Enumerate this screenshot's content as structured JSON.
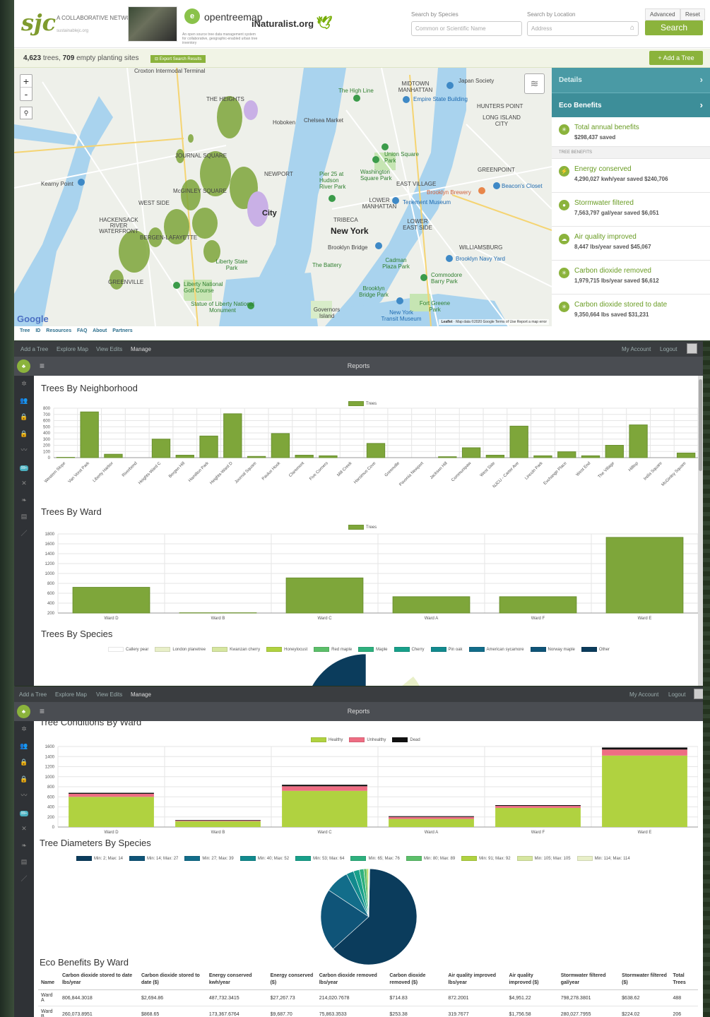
{
  "panel1": {
    "logo": {
      "sjc": "sjc",
      "network": "A COLLABORATIVE NETWORK",
      "url": "sustainablejc.org",
      "otm_name": "opentreemap",
      "otm_tagline": "An open source tree data management system for collaborative, geographic-enabled urban tree inventory",
      "inat": "iNaturalist.org"
    },
    "search": {
      "species_label": "Search by Species",
      "species_placeholder": "Common or Scientific Name",
      "location_label": "Search by Location",
      "location_placeholder": "Address",
      "advanced": "Advanced",
      "reset": "Reset",
      "search_button": "Search"
    },
    "counts": {
      "trees": "4,623",
      "trees_word": "trees,",
      "empty": "709",
      "empty_word": "empty planting sites"
    },
    "export_button": "Export Search Results",
    "add_tree_button": "+ Add a Tree",
    "map": {
      "zoom_in": "+",
      "zoom_out": "-",
      "google": "Google",
      "attribution": "Map data ©2020 Google   Terms of Use   Report a map error",
      "leaflet": "Leaflet",
      "labels": [
        "Croxton Intermodal Terminal",
        "THE HEIGHTS",
        "Hoboken",
        "Kearny Point",
        "JOURNAL SQUARE",
        "NEWPORT",
        "WEST SIDE",
        "McGINLEY SQUARE",
        "HACKENSACK RIVER WATERFRONT",
        "BERGEN-LAFAYETTE",
        "GREENVILLE",
        "Liberty State Park",
        "Liberty National Golf Course",
        "Statue of Liberty National Monument",
        "Governors Island",
        "New York",
        "TRIBECA",
        "LOWER MANHATTAN",
        "EAST VILLAGE",
        "LOWER EAST SIDE",
        "MIDTOWN MANHATTAN",
        "The High Line",
        "Empire State Building",
        "Chelsea Market",
        "Union Square Park",
        "Washington Square Park",
        "Pier 25 at Hudson River Park",
        "Brooklyn Bridge",
        "The Battery",
        "Cadman Plaza Park",
        "Brooklyn Bridge Park",
        "WILLIAMSBURG",
        "Brooklyn Navy Yard",
        "Commodore Barry Park",
        "Fort Greene Park",
        "GREENPOINT",
        "HUNTERS POINT",
        "LONG ISLAND CITY",
        "Brooklyn Brewery",
        "Beacon's Closet",
        "Tenement Museum",
        "Japan Society",
        "City",
        "New York Transit Museum"
      ]
    },
    "sidebar": {
      "details": "Details",
      "eco": "Eco Benefits",
      "total": {
        "name": "Total annual benefits",
        "value": "$298,437 saved"
      },
      "tree_benefits_header": "TREE BENEFITS",
      "benefits": [
        {
          "icon": "lightning-icon",
          "glyph": "⚡",
          "name": "Energy conserved",
          "value": "4,290,027 kwh/year saved $240,706"
        },
        {
          "icon": "water-drop-icon",
          "glyph": "●",
          "name": "Stormwater filtered",
          "value": "7,563,797 gal/year saved $6,051"
        },
        {
          "icon": "cloud-icon",
          "glyph": "☁",
          "name": "Air quality improved",
          "value": "8,447 lbs/year saved $45,067"
        },
        {
          "icon": "co2-icon",
          "glyph": "✳",
          "name": "Carbon dioxide removed",
          "value": "1,979,715 lbs/year saved $6,612"
        },
        {
          "icon": "co2-icon",
          "glyph": "✳",
          "name": "Carbon dioxide stored to date",
          "value": "9,350,664 lbs saved $31,231"
        }
      ]
    },
    "footer": "Tree ID   Resources   FAQ   About   Partners"
  },
  "manage": {
    "nav": [
      "Add a Tree",
      "Explore Map",
      "View Edits",
      "Manage"
    ],
    "account": "My Account",
    "logout": "Logout",
    "title": "Reports",
    "badge": "99+"
  },
  "colors": {
    "green": "#8bb33c",
    "teal": "#3d8e99",
    "healthy": "#b0d240",
    "unhealthy": "#ee6d83",
    "dead": "#111111"
  },
  "chart_data": [
    {
      "type": "bar",
      "title": "Trees By Neighborhood",
      "legend": [
        "Trees"
      ],
      "categories": [
        "Western Slope",
        "Van Vorst Park",
        "Liberty Harbor",
        "Riverbend",
        "Heights-Ward C",
        "Bergen Hill",
        "Hamilton Park",
        "Heights-Ward D",
        "Journal Square",
        "Paulus Hook",
        "Claremont",
        "Five Corners",
        "Mill Creek",
        "Harsimus Cove",
        "Greenville",
        "Pavonia Newport",
        "Jackson Hill",
        "Communipaw",
        "West Side",
        "NJCU - Carter Ave",
        "Lincoln Park",
        "Exchange Place",
        "West End",
        "The Village",
        "Hilltop",
        "India Square",
        "McGinley Square"
      ],
      "values": [
        5,
        740,
        55,
        0,
        300,
        40,
        350,
        710,
        20,
        390,
        40,
        30,
        0,
        230,
        0,
        0,
        15,
        160,
        40,
        510,
        30,
        95,
        30,
        200,
        530,
        0,
        75
      ],
      "ylim": [
        0,
        800
      ],
      "yticks": [
        0,
        100,
        200,
        300,
        400,
        500,
        600,
        700,
        800
      ]
    },
    {
      "type": "bar",
      "title": "Trees By Ward",
      "legend": [
        "Trees"
      ],
      "categories": [
        "Ward D",
        "Ward B",
        "Ward C",
        "Ward A",
        "Ward F",
        "Ward E"
      ],
      "values": [
        720,
        205,
        910,
        530,
        530,
        1730
      ],
      "ylim": [
        200,
        1800
      ],
      "yticks": [
        200,
        400,
        600,
        800,
        1000,
        1200,
        1400,
        1600,
        1800
      ]
    },
    {
      "type": "pie",
      "title": "Trees By Species",
      "categories": [
        "Callery pear",
        "London planetree",
        "Kwanzan cherry",
        "Honeylocust",
        "Red maple",
        "Maple",
        "Cherry",
        "Pin oak",
        "American sycamore",
        "Norway maple",
        "Other"
      ],
      "colors": [
        "#ffffff",
        "#e8efc8",
        "#d6e6a0",
        "#b0d240",
        "#5cbf6a",
        "#2eb07e",
        "#18a08a",
        "#128a8e",
        "#126d8a",
        "#0f5478",
        "#0b3c5c"
      ],
      "values": [
        14,
        7,
        3,
        8,
        6,
        3,
        2,
        2,
        3,
        2,
        50
      ]
    },
    {
      "type": "bar",
      "stacked": true,
      "title": "Tree Conditions By Ward",
      "categories": [
        "Ward D",
        "Ward B",
        "Ward C",
        "Ward A",
        "Ward F",
        "Ward E"
      ],
      "series": [
        {
          "name": "Healthy",
          "values": [
            600,
            115,
            720,
            160,
            380,
            1420
          ]
        },
        {
          "name": "Unhealthy",
          "values": [
            60,
            15,
            90,
            40,
            40,
            120
          ]
        },
        {
          "name": "Dead",
          "values": [
            20,
            10,
            30,
            15,
            15,
            40
          ]
        }
      ],
      "ylim": [
        0,
        1600
      ],
      "yticks": [
        0,
        200,
        400,
        600,
        800,
        1000,
        1200,
        1400,
        1600
      ]
    },
    {
      "type": "pie",
      "title": "Tree Diameters By Species",
      "categories": [
        "Min: 2; Max: 14",
        "Min: 14; Max: 27",
        "Min: 27; Max: 39",
        "Min: 40; Max: 52",
        "Min: 53; Max: 64",
        "Min: 65; Max: 76",
        "Min: 80; Max: 89",
        "Min: 91; Max: 92",
        "Min: 105; Max: 105",
        "Min: 114; Max: 114"
      ],
      "colors": [
        "#0b3c5c",
        "#0f5478",
        "#126d8a",
        "#128a8e",
        "#18a08a",
        "#2eb07e",
        "#5cbf6a",
        "#b0d240",
        "#d6e6a0",
        "#e8efc8"
      ],
      "values": [
        63,
        21,
        8,
        2.5,
        2,
        1.5,
        1,
        0.5,
        0.3,
        0.2
      ]
    },
    {
      "type": "table",
      "title": "Eco Benefits By Ward",
      "columns": [
        "Name",
        "Carbon dioxide stored to date lbs/year",
        "Carbon dioxide stored to date ($)",
        "Energy conserved kwh/year",
        "Energy conserved ($)",
        "Carbon dioxide removed lbs/year",
        "Carbon dioxide removed ($)",
        "Air quality improved lbs/year",
        "Air quality improved ($)",
        "Stormwater filtered gal/year",
        "Stormwater filtered ($)",
        "Total Trees"
      ],
      "rows": [
        [
          "Ward A",
          "806,844.3018",
          "$2,694.86",
          "487,732.3415",
          "$27,267.73",
          "214,020.7678",
          "$714.83",
          "872.2001",
          "$4,951.22",
          "798,278.3801",
          "$638.62",
          "488"
        ],
        [
          "Ward B",
          "260,073.8951",
          "$868.65",
          "173,367.6764",
          "$9,687.70",
          "75,863.3533",
          "$253.38",
          "319.7677",
          "$1,756.58",
          "280,027.7955",
          "$224.02",
          "206"
        ]
      ]
    }
  ]
}
